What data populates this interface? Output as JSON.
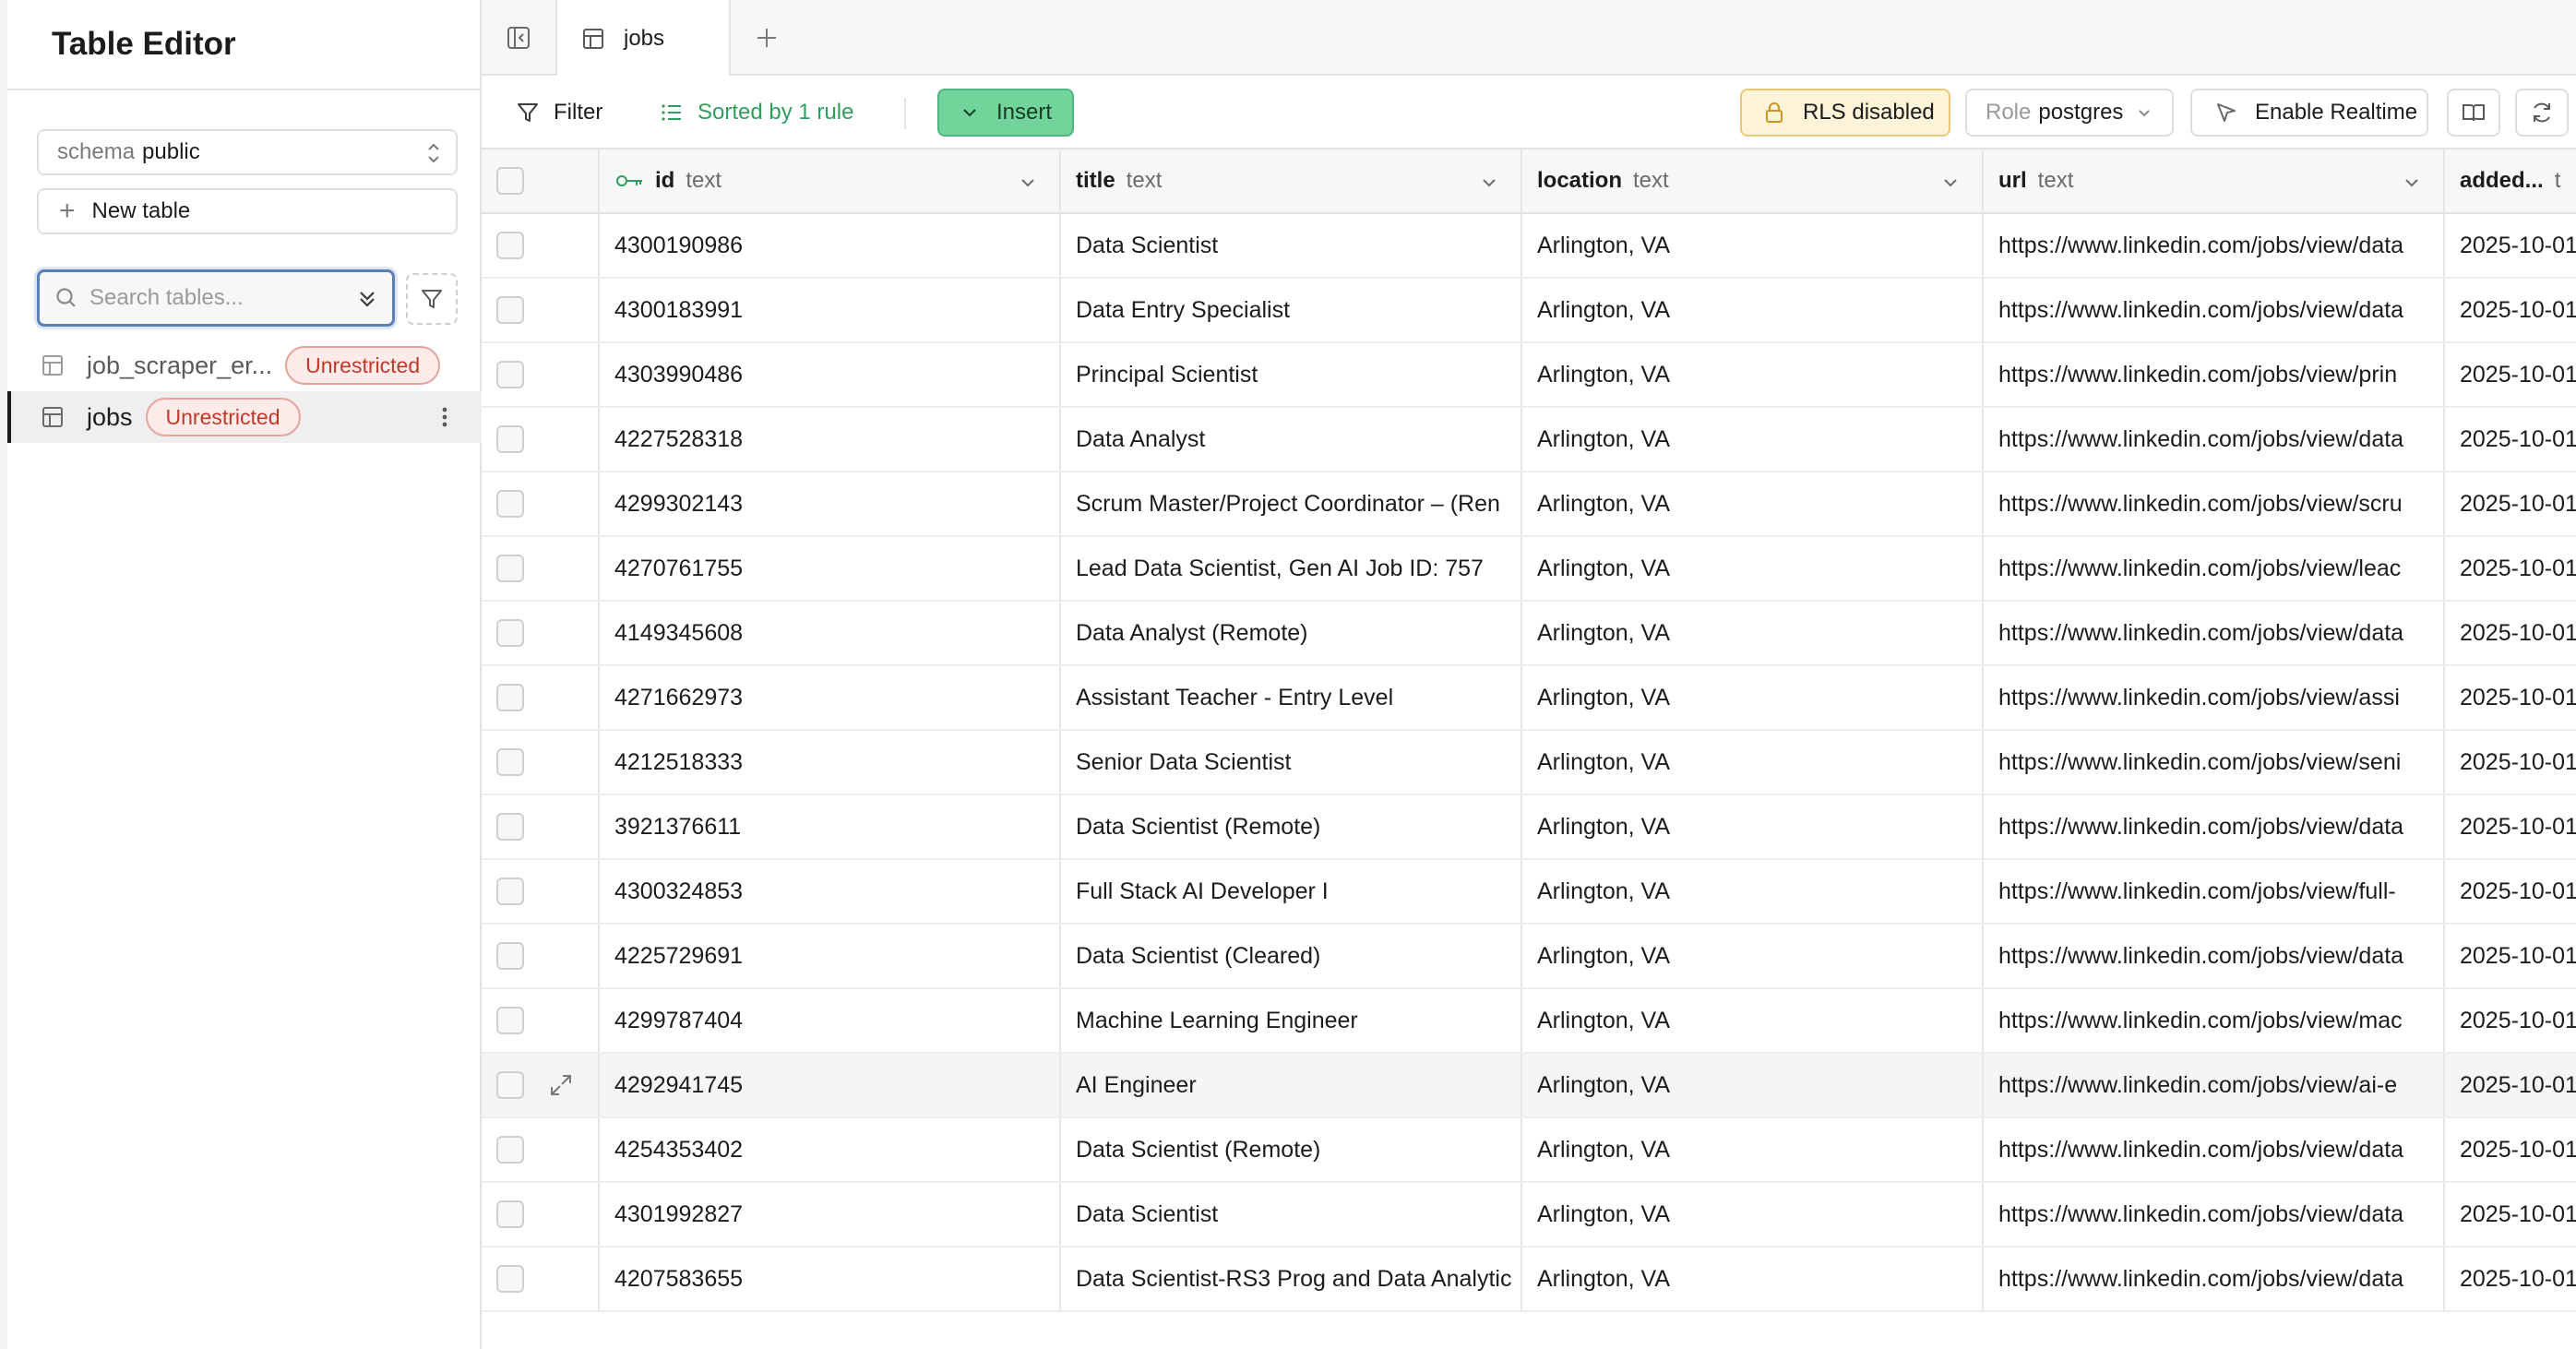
{
  "sidebar": {
    "title": "Table Editor",
    "schema_label": "schema",
    "schema_value": "public",
    "new_table_label": "New table",
    "search_placeholder": "Search tables...",
    "tables": [
      {
        "name": "job_scraper_er...",
        "badge": "Unrestricted",
        "selected": false
      },
      {
        "name": "jobs",
        "badge": "Unrestricted",
        "selected": true
      }
    ]
  },
  "tabs": {
    "active_tab": "jobs",
    "add_tab_icon": "plus-icon"
  },
  "toolbar": {
    "filter_label": "Filter",
    "sort_label": "Sorted by 1 rule",
    "insert_label": "Insert",
    "rls_label": "RLS disabled",
    "role_label": "Role",
    "role_value": "postgres",
    "realtime_label": "Enable Realtime"
  },
  "columns": [
    {
      "name": "id",
      "type": "text"
    },
    {
      "name": "title",
      "type": "text"
    },
    {
      "name": "location",
      "type": "text"
    },
    {
      "name": "url",
      "type": "text"
    },
    {
      "name": "added...",
      "type": "t"
    }
  ],
  "rows": [
    {
      "id": "4300190986",
      "title": "Data Scientist",
      "location": "Arlington, VA",
      "url": "https://www.linkedin.com/jobs/view/data",
      "added": "2025-10-01"
    },
    {
      "id": "4300183991",
      "title": "Data Entry Specialist",
      "location": "Arlington, VA",
      "url": "https://www.linkedin.com/jobs/view/data",
      "added": "2025-10-01"
    },
    {
      "id": "4303990486",
      "title": "Principal Scientist",
      "location": "Arlington, VA",
      "url": "https://www.linkedin.com/jobs/view/prin",
      "added": "2025-10-01"
    },
    {
      "id": "4227528318",
      "title": "Data Analyst",
      "location": "Arlington, VA",
      "url": "https://www.linkedin.com/jobs/view/data",
      "added": "2025-10-01"
    },
    {
      "id": "4299302143",
      "title": "Scrum Master/Project Coordinator – (Ren",
      "location": "Arlington, VA",
      "url": "https://www.linkedin.com/jobs/view/scru",
      "added": "2025-10-01"
    },
    {
      "id": "4270761755",
      "title": "Lead Data Scientist, Gen AI Job ID: 757",
      "location": "Arlington, VA",
      "url": "https://www.linkedin.com/jobs/view/leac",
      "added": "2025-10-01"
    },
    {
      "id": "4149345608",
      "title": "Data Analyst (Remote)",
      "location": "Arlington, VA",
      "url": "https://www.linkedin.com/jobs/view/data",
      "added": "2025-10-01"
    },
    {
      "id": "4271662973",
      "title": "Assistant Teacher - Entry Level",
      "location": "Arlington, VA",
      "url": "https://www.linkedin.com/jobs/view/assi",
      "added": "2025-10-01"
    },
    {
      "id": "4212518333",
      "title": "Senior Data Scientist",
      "location": "Arlington, VA",
      "url": "https://www.linkedin.com/jobs/view/seni",
      "added": "2025-10-01"
    },
    {
      "id": "3921376611",
      "title": "Data Scientist (Remote)",
      "location": "Arlington, VA",
      "url": "https://www.linkedin.com/jobs/view/data",
      "added": "2025-10-01"
    },
    {
      "id": "4300324853",
      "title": "Full Stack AI Developer I",
      "location": "Arlington, VA",
      "url": "https://www.linkedin.com/jobs/view/full-",
      "added": "2025-10-01"
    },
    {
      "id": "4225729691",
      "title": "Data Scientist (Cleared)",
      "location": "Arlington, VA",
      "url": "https://www.linkedin.com/jobs/view/data",
      "added": "2025-10-01"
    },
    {
      "id": "4299787404",
      "title": "Machine Learning Engineer",
      "location": "Arlington, VA",
      "url": "https://www.linkedin.com/jobs/view/mac",
      "added": "2025-10-01"
    },
    {
      "id": "4292941745",
      "title": "AI Engineer",
      "location": "Arlington, VA",
      "url": "https://www.linkedin.com/jobs/view/ai-e",
      "added": "2025-10-01"
    },
    {
      "id": "4254353402",
      "title": "Data Scientist (Remote)",
      "location": "Arlington, VA",
      "url": "https://www.linkedin.com/jobs/view/data",
      "added": "2025-10-01"
    },
    {
      "id": "4301992827",
      "title": "Data Scientist",
      "location": "Arlington, VA",
      "url": "https://www.linkedin.com/jobs/view/data",
      "added": "2025-10-01"
    },
    {
      "id": "4207583655",
      "title": "Data Scientist-RS3 Prog and Data Analytic",
      "location": "Arlington, VA",
      "url": "https://www.linkedin.com/jobs/view/data",
      "added": "2025-10-01"
    }
  ],
  "colors": {
    "accent_green": "#2f9e5f",
    "insert_bg": "#72d49b",
    "rls_bg": "#fdf3d9",
    "badge_red": "#c0392b"
  }
}
